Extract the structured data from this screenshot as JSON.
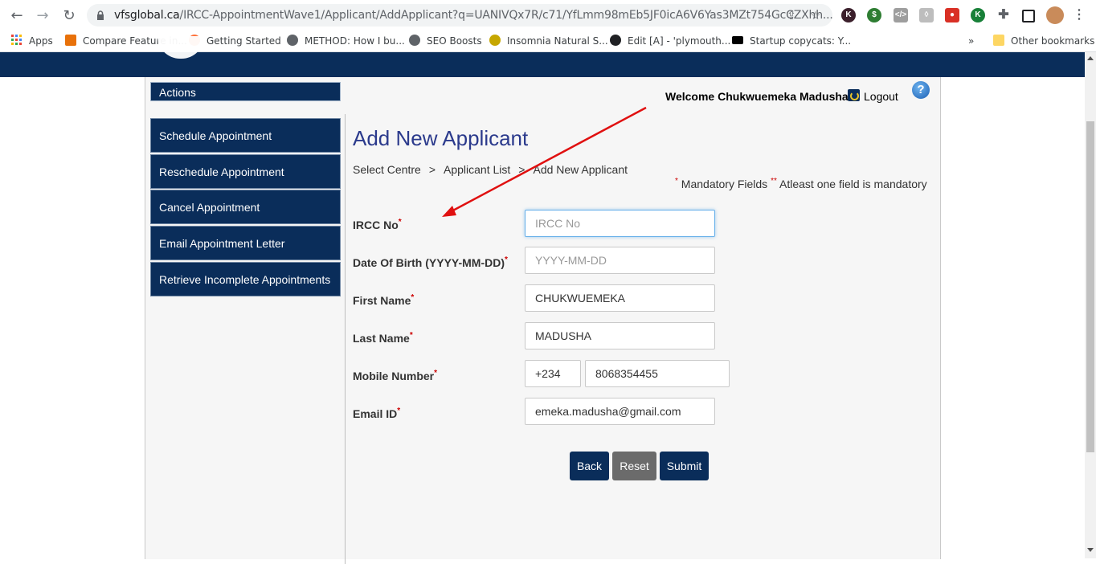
{
  "browser": {
    "url_host": "vfsglobal.ca",
    "url_path": "/IRCC-AppointmentWave1/Applicant/AddApplicant?q=UANIVQx7R/c71/YfLmm98mEb5JF0icA6V6Yas3MZt754GcCZXhh...",
    "bookmarks": [
      {
        "label": "Apps",
        "icon": "apps-grid-icon",
        "color": "#ea4335"
      },
      {
        "label": "Compare Feature in...",
        "icon": "v-icon",
        "color": "#e8710a"
      },
      {
        "label": "Getting Started",
        "icon": "firefox-icon",
        "color": "#ff7139"
      },
      {
        "label": "METHOD: How I bu...",
        "icon": "globe-icon",
        "color": "#5f6368"
      },
      {
        "label": "SEO Boosts",
        "icon": "globe-icon",
        "color": "#5f6368"
      },
      {
        "label": "Insomnia Natural S...",
        "icon": "flower-icon",
        "color": "#c6a700"
      },
      {
        "label": "Edit [A] - 'plymouth...",
        "icon": "wordpress-icon",
        "color": "#202124"
      },
      {
        "label": "Startup copycats: Y...",
        "icon": "tnw-icon",
        "color": "#000000"
      }
    ],
    "more_bookmarks": "»",
    "other_bookmarks": "Other bookmarks"
  },
  "sidebar": {
    "header": "Actions",
    "items": [
      {
        "label": "Schedule Appointment"
      },
      {
        "label": "Reschedule Appointment"
      },
      {
        "label": "Cancel Appointment"
      },
      {
        "label": "Email Appointment Letter"
      },
      {
        "label": "Retrieve Incomplete Appointments"
      }
    ]
  },
  "header": {
    "welcome": "Welcome Chukwuemeka Madusha !",
    "logout": "Logout",
    "help": "?"
  },
  "main": {
    "title": "Add New Applicant",
    "breadcrumb": [
      "Select Centre",
      "Applicant List",
      "Add New Applicant"
    ],
    "breadcrumb_sep": ">",
    "mandatory_note": "Mandatory Fields",
    "atleast_note": "Atleast one field is mandatory",
    "req_mark": "*",
    "req_mark_double": "**"
  },
  "form": {
    "ircc": {
      "label": "IRCC No",
      "placeholder": "IRCC No",
      "value": ""
    },
    "dob": {
      "label": "Date Of Birth (YYYY-MM-DD)",
      "placeholder": "YYYY-MM-DD",
      "value": ""
    },
    "first_name": {
      "label": "First Name",
      "value": "CHUKWUEMEKA"
    },
    "last_name": {
      "label": "Last Name",
      "value": "MADUSHA"
    },
    "mobile": {
      "label": "Mobile Number",
      "code": "+234",
      "number": "8068354455"
    },
    "email": {
      "label": "Email ID",
      "value": "emeka.madusha@gmail.com"
    }
  },
  "buttons": {
    "back": "Back",
    "reset": "Reset",
    "submit": "Submit"
  },
  "colors": {
    "navy": "#0a2d5a",
    "reset_gray": "#6b6b6b",
    "annotation_arrow": "#e01010",
    "title": "#2b3a8c"
  }
}
